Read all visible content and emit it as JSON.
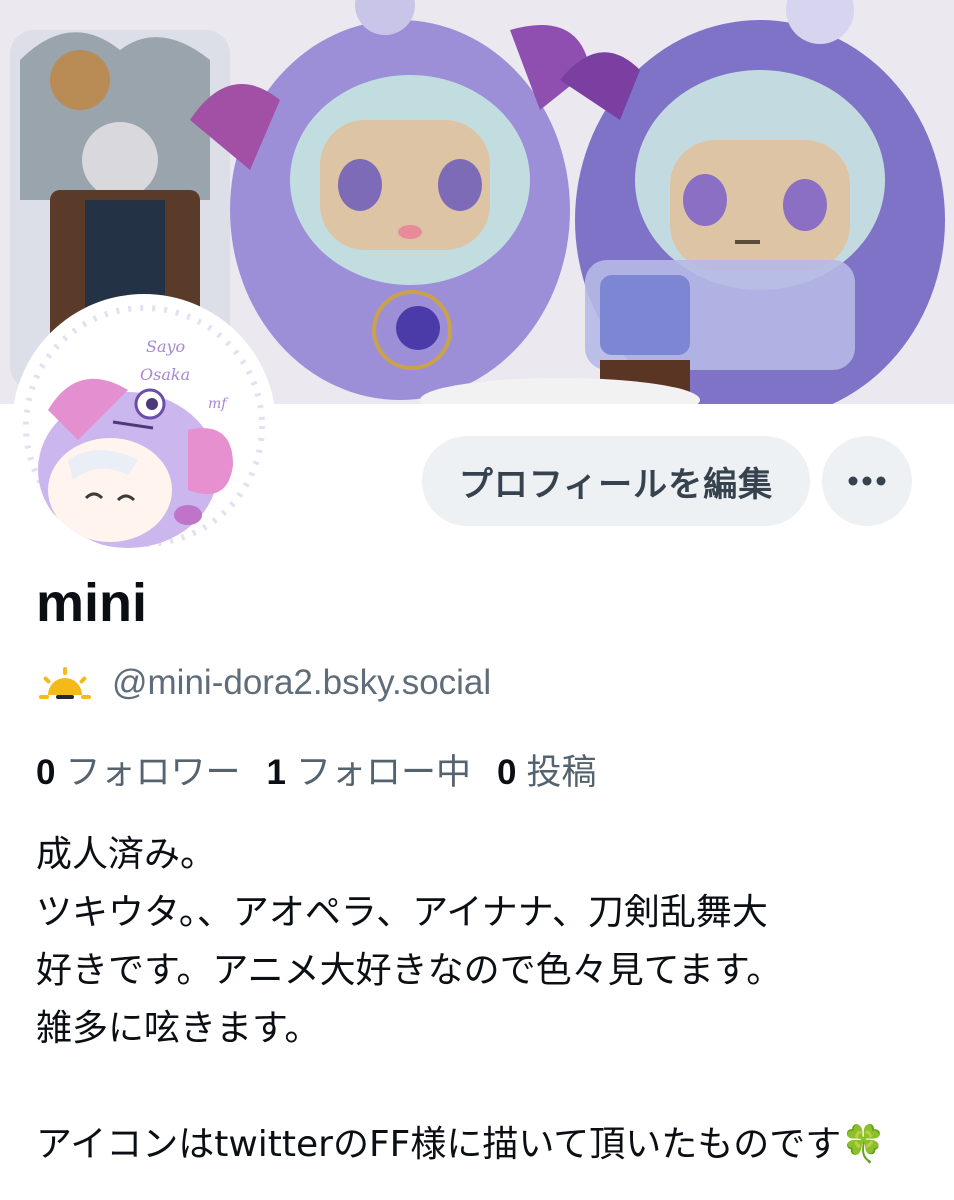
{
  "profile": {
    "display_name": "mini",
    "handle": "@mini-dora2.bsky.social",
    "handle_icon": "sun-icon",
    "avatar_text": [
      "Sayo",
      "Osaka",
      "mf"
    ]
  },
  "actions": {
    "edit_label": "プロフィールを編集",
    "more_icon": "more-horizontal-icon"
  },
  "stats": [
    {
      "value": "0",
      "label": "フォロワー"
    },
    {
      "value": "1",
      "label": "フォロー中"
    },
    {
      "value": "0",
      "label": "投稿"
    }
  ],
  "bio": {
    "line1": "成人済み。",
    "line2": "ツキウタ。、アオペラ、アイナナ、刀剣乱舞大",
    "line3": "好きです。アニメ大好きなので色々見てます。",
    "line4": "雑多に呟きます。",
    "line5": "アイコンはtwitterのFF様に描いて頂いたものです",
    "clover": "🍀"
  },
  "colors": {
    "button_bg": "#eef1f4",
    "secondary_text": "#5f6d7b",
    "plush_purple": "#9a8cd6",
    "sun_yellow": "#f5b91b"
  }
}
